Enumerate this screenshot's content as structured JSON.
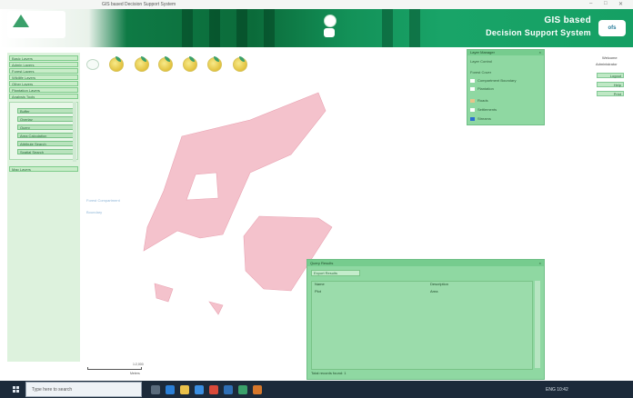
{
  "window": {
    "title": "GIS based Decision Support System"
  },
  "banner": {
    "title_line1": "GIS based",
    "title_line2": "Decision Support System",
    "right_logo_text": "ofs"
  },
  "sidebar": {
    "items": [
      {
        "label": "Basic Layers"
      },
      {
        "label": "Admin Layers"
      },
      {
        "label": "Forest Layers"
      },
      {
        "label": "Wildlife Layers"
      },
      {
        "label": "Other Layers"
      },
      {
        "label": "Plantation Layers"
      },
      {
        "label": "Analysis Tools"
      }
    ],
    "sub_items": [
      {
        "label": "Buffer"
      },
      {
        "label": "Overlay"
      },
      {
        "label": "Query"
      },
      {
        "label": "Area Calculation"
      },
      {
        "label": "Attribute Search"
      },
      {
        "label": "Spatial Search"
      }
    ],
    "bottom_item": "Map Layers"
  },
  "map": {
    "label1": "Forest Compartment",
    "label2": "Boundary",
    "scale_label": "1:2,000",
    "scale_text": "Meters"
  },
  "layers_panel": {
    "title": "Layer Manager",
    "subtitle": "Layer Control",
    "layers": [
      {
        "label": "Forest Cover"
      },
      {
        "label": "Compartment Boundary"
      },
      {
        "label": "Plantation"
      },
      {
        "label": "Roads"
      },
      {
        "label": "Settlements"
      },
      {
        "label": "Streams"
      }
    ],
    "colors": {
      "plantation": "#e8c48a",
      "streams": "#2c6fd1"
    }
  },
  "right_sidebar": {
    "user_line1": "Welcome",
    "user_line2": "Administrator",
    "buttons": [
      {
        "label": "Logout"
      },
      {
        "label": "Help"
      },
      {
        "label": "Print"
      }
    ]
  },
  "results_panel": {
    "title": "Query Results",
    "export_button": "Export Results",
    "columns": [
      {
        "label": "Name"
      },
      {
        "label": "Description"
      }
    ],
    "rows": [
      [
        "Plot",
        "Area"
      ]
    ],
    "footer": "Total records found: 1"
  },
  "taskbar": {
    "search_placeholder": "Type here to search",
    "tray_text": "ENG  10:42"
  },
  "colors": {
    "banner_green": "#0b6b3a",
    "panel_green": "#8fd8a2",
    "polygon_pink": "#f4c2cc"
  }
}
